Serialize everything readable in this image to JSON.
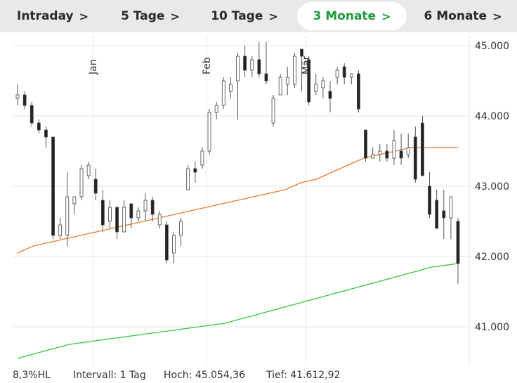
{
  "tabs": [
    {
      "label": "Intraday",
      "active": false
    },
    {
      "label": "5 Tage",
      "active": false
    },
    {
      "label": "10 Tage",
      "active": false
    },
    {
      "label": "3 Monate",
      "active": true
    },
    {
      "label": "6 Monate",
      "active": false
    }
  ],
  "tab_chevron": ">",
  "colors": {
    "active_tab": "#1f9b3c",
    "tabbar_bg": "#e9e9e9",
    "ma_orange": "#f07a2a",
    "ma_green": "#32c83a",
    "candle": "#222222",
    "grid": "#e6e6e6"
  },
  "footer": {
    "scale": "8,3%HL",
    "interval": "Intervall: 1 Tag",
    "high": "Hoch: 45.054,36",
    "low": "Tief: 41.612,92"
  },
  "chart_data": {
    "type": "candlestick",
    "ylim": [
      40450,
      45150
    ],
    "yticks": [
      45000,
      44000,
      43000,
      42000,
      41000
    ],
    "ytick_labels": [
      "45.000",
      "44.000",
      "43.000",
      "42.000",
      "41.000"
    ],
    "month_labels": [
      {
        "label": "Jan",
        "index": 11
      },
      {
        "label": "Feb",
        "index": 27
      },
      {
        "label": "Mär",
        "index": 41
      }
    ],
    "grid": true,
    "candles": [
      {
        "o": 44250,
        "h": 44450,
        "l": 44150,
        "c": 44300
      },
      {
        "o": 44300,
        "h": 44350,
        "l": 44100,
        "c": 44150
      },
      {
        "o": 44150,
        "h": 44200,
        "l": 43850,
        "c": 43900
      },
      {
        "o": 43900,
        "h": 43950,
        "l": 43750,
        "c": 43800
      },
      {
        "o": 43800,
        "h": 43850,
        "l": 43550,
        "c": 43700
      },
      {
        "o": 43700,
        "h": 43700,
        "l": 42250,
        "c": 42300
      },
      {
        "o": 42300,
        "h": 42550,
        "l": 42250,
        "c": 42450
      },
      {
        "o": 42300,
        "h": 43200,
        "l": 42150,
        "c": 42850
      },
      {
        "o": 42750,
        "h": 42850,
        "l": 42600,
        "c": 42850
      },
      {
        "o": 42850,
        "h": 43300,
        "l": 42800,
        "c": 43250
      },
      {
        "o": 43150,
        "h": 43350,
        "l": 43100,
        "c": 43300
      },
      {
        "o": 43100,
        "h": 43250,
        "l": 42800,
        "c": 42900
      },
      {
        "o": 42800,
        "h": 42950,
        "l": 42350,
        "c": 42450
      },
      {
        "o": 42500,
        "h": 42800,
        "l": 42400,
        "c": 42700
      },
      {
        "o": 42700,
        "h": 42700,
        "l": 42250,
        "c": 42350
      },
      {
        "o": 42350,
        "h": 42800,
        "l": 42350,
        "c": 42700
      },
      {
        "o": 42750,
        "h": 42750,
        "l": 42400,
        "c": 42550
      },
      {
        "o": 42550,
        "h": 42700,
        "l": 42500,
        "c": 42650
      },
      {
        "o": 42650,
        "h": 42900,
        "l": 42500,
        "c": 42800
      },
      {
        "o": 42800,
        "h": 42850,
        "l": 42500,
        "c": 42600
      },
      {
        "o": 42450,
        "h": 42650,
        "l": 42400,
        "c": 42600
      },
      {
        "o": 42450,
        "h": 42500,
        "l": 41900,
        "c": 41950
      },
      {
        "o": 42050,
        "h": 42350,
        "l": 41900,
        "c": 42300
      },
      {
        "o": 42300,
        "h": 42550,
        "l": 42150,
        "c": 42500
      },
      {
        "o": 42950,
        "h": 43300,
        "l": 42950,
        "c": 43250
      },
      {
        "o": 43250,
        "h": 43350,
        "l": 43050,
        "c": 43200
      },
      {
        "o": 43300,
        "h": 43550,
        "l": 43250,
        "c": 43500
      },
      {
        "o": 43500,
        "h": 44100,
        "l": 43450,
        "c": 44050
      },
      {
        "o": 44050,
        "h": 44200,
        "l": 43950,
        "c": 44150
      },
      {
        "o": 44150,
        "h": 44550,
        "l": 44100,
        "c": 44500
      },
      {
        "o": 44350,
        "h": 44550,
        "l": 44250,
        "c": 44450
      },
      {
        "o": 44500,
        "h": 44900,
        "l": 43950,
        "c": 44850
      },
      {
        "o": 44850,
        "h": 45000,
        "l": 44550,
        "c": 44650
      },
      {
        "o": 44650,
        "h": 44850,
        "l": 44550,
        "c": 44800
      },
      {
        "o": 44800,
        "h": 45050,
        "l": 44550,
        "c": 44600
      },
      {
        "o": 44600,
        "h": 45050,
        "l": 44450,
        "c": 44500
      }
    ],
    "candles_b": [
      {
        "o": 43900,
        "h": 44300,
        "l": 43850,
        "c": 44250
      },
      {
        "o": 44300,
        "h": 44600,
        "l": 44300,
        "c": 44550
      },
      {
        "o": 44450,
        "h": 44700,
        "l": 44300,
        "c": 44550
      },
      {
        "o": 44450,
        "h": 44900,
        "l": 44400,
        "c": 44850
      },
      {
        "o": 44950,
        "h": 44950,
        "l": 44350,
        "c": 44850
      },
      {
        "o": 44800,
        "h": 44850,
        "l": 44150,
        "c": 44200
      },
      {
        "o": 44350,
        "h": 44600,
        "l": 44300,
        "c": 44450
      },
      {
        "o": 44400,
        "h": 44550,
        "l": 44250,
        "c": 44500
      },
      {
        "o": 44350,
        "h": 44500,
        "l": 44050,
        "c": 44250
      },
      {
        "o": 44550,
        "h": 44700,
        "l": 44450,
        "c": 44650
      },
      {
        "o": 44700,
        "h": 44750,
        "l": 44450,
        "c": 44550
      },
      {
        "o": 44550,
        "h": 44600,
        "l": 44450,
        "c": 44600
      },
      {
        "o": 44600,
        "h": 44650,
        "l": 44050,
        "c": 44100
      },
      {
        "o": 43800,
        "h": 43800,
        "l": 43350,
        "c": 43400
      },
      {
        "o": 43400,
        "h": 43550,
        "l": 43400,
        "c": 43450
      },
      {
        "o": 43450,
        "h": 43600,
        "l": 43350,
        "c": 43500
      },
      {
        "o": 43500,
        "h": 43600,
        "l": 43350,
        "c": 43400
      },
      {
        "o": 43400,
        "h": 43800,
        "l": 43300,
        "c": 43650
      },
      {
        "o": 43500,
        "h": 43750,
        "l": 43300,
        "c": 43400
      },
      {
        "o": 43450,
        "h": 43750,
        "l": 43400,
        "c": 43550
      },
      {
        "o": 43700,
        "h": 43850,
        "l": 43050,
        "c": 43100
      },
      {
        "o": 43900,
        "h": 44000,
        "l": 43150,
        "c": 43150
      },
      {
        "o": 43000,
        "h": 43200,
        "l": 42550,
        "c": 42600
      },
      {
        "o": 42800,
        "h": 42950,
        "l": 42400,
        "c": 42400
      },
      {
        "o": 42650,
        "h": 42950,
        "l": 42250,
        "c": 42550
      },
      {
        "o": 42550,
        "h": 42800,
        "l": 42250,
        "c": 42850
      },
      {
        "o": 42500,
        "h": 42550,
        "l": 41613,
        "c": 41900
      }
    ],
    "ma_orange": [
      42050,
      42150,
      42200,
      42250,
      42300,
      42350,
      42400,
      42450,
      42500,
      42550,
      42600,
      42650,
      42700,
      42750,
      42800,
      42850,
      42900,
      42950,
      43050,
      43100,
      43200,
      43300,
      43400,
      43450,
      43500,
      43550,
      43550,
      43550,
      43550
    ],
    "ma_green": [
      40550,
      40650,
      40750,
      40800,
      40850,
      40900,
      40950,
      41000,
      41050,
      41150,
      41250,
      41350,
      41450,
      41550,
      41650,
      41750,
      41850,
      41900
    ]
  }
}
